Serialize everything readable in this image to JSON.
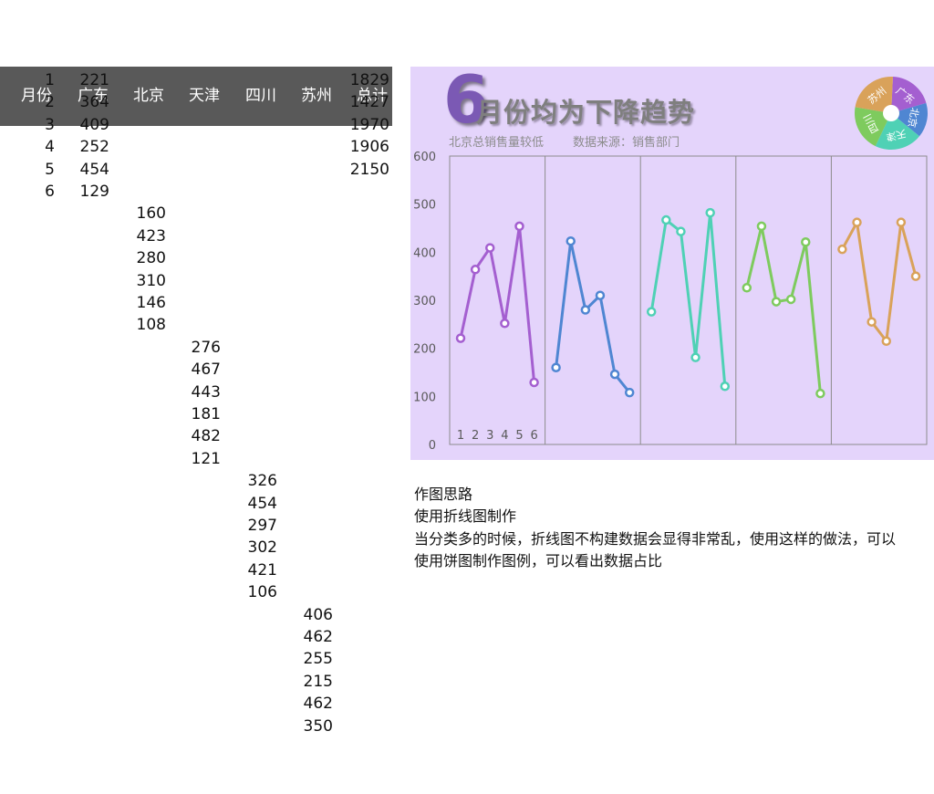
{
  "table": {
    "headers": [
      "月份",
      "广东",
      "北京",
      "天津",
      "四川",
      "苏州",
      "总计"
    ],
    "months": [
      "1",
      "2",
      "3",
      "4",
      "5",
      "6"
    ],
    "region_values": [
      [
        "221",
        "364",
        "409",
        "252",
        "454",
        "129"
      ],
      [
        "160",
        "423",
        "280",
        "310",
        "146",
        "108"
      ],
      [
        "276",
        "467",
        "443",
        "181",
        "482",
        "121"
      ],
      [
        "326",
        "454",
        "297",
        "302",
        "421",
        "106"
      ],
      [
        "406",
        "462",
        "255",
        "215",
        "462",
        "350"
      ]
    ],
    "totals": [
      "1829",
      "1427",
      "1970",
      "1906",
      "2150"
    ]
  },
  "chart_title": {
    "digit": "6",
    "text": "月份均为下降趋势",
    "subtitle_left": "北京总销售量较低",
    "subtitle_right": "数据来源：销售部门"
  },
  "chart_data": [
    {
      "type": "line",
      "x": [
        "1",
        "2",
        "3",
        "4",
        "5",
        "6"
      ],
      "ylim": [
        0,
        600
      ],
      "yticks": [
        "0",
        "100",
        "200",
        "300",
        "400",
        "500",
        "600"
      ],
      "grid": false,
      "series": [
        {
          "name": "广东",
          "color": "#a45fd0",
          "values": [
            221,
            364,
            409,
            252,
            454,
            129
          ]
        },
        {
          "name": "北京",
          "color": "#4f86d2",
          "values": [
            160,
            423,
            280,
            310,
            146,
            108
          ]
        },
        {
          "name": "天津",
          "color": "#4fd1b5",
          "values": [
            276,
            467,
            443,
            181,
            482,
            121
          ]
        },
        {
          "name": "四川",
          "color": "#7ecb5e",
          "values": [
            326,
            454,
            297,
            302,
            421,
            106
          ]
        },
        {
          "name": "苏州",
          "color": "#d9a25a",
          "values": [
            406,
            462,
            255,
            215,
            462,
            350
          ]
        }
      ]
    },
    {
      "type": "pie",
      "labels": [
        "广东",
        "北京",
        "天津",
        "四川",
        "苏州"
      ],
      "values": [
        1829,
        1427,
        1970,
        1906,
        2150
      ],
      "colors": [
        "#a45fd0",
        "#4f86d2",
        "#4fd1b5",
        "#7ecb5e",
        "#d9a25a"
      ]
    }
  ],
  "notes": {
    "lines": [
      "作图思路",
      "使用折线图制作",
      "当分类多的时候，折线图不构建数据会显得非常乱，使用这样的做法，可以",
      "使用饼图制作图例，可以看出数据占比"
    ]
  }
}
